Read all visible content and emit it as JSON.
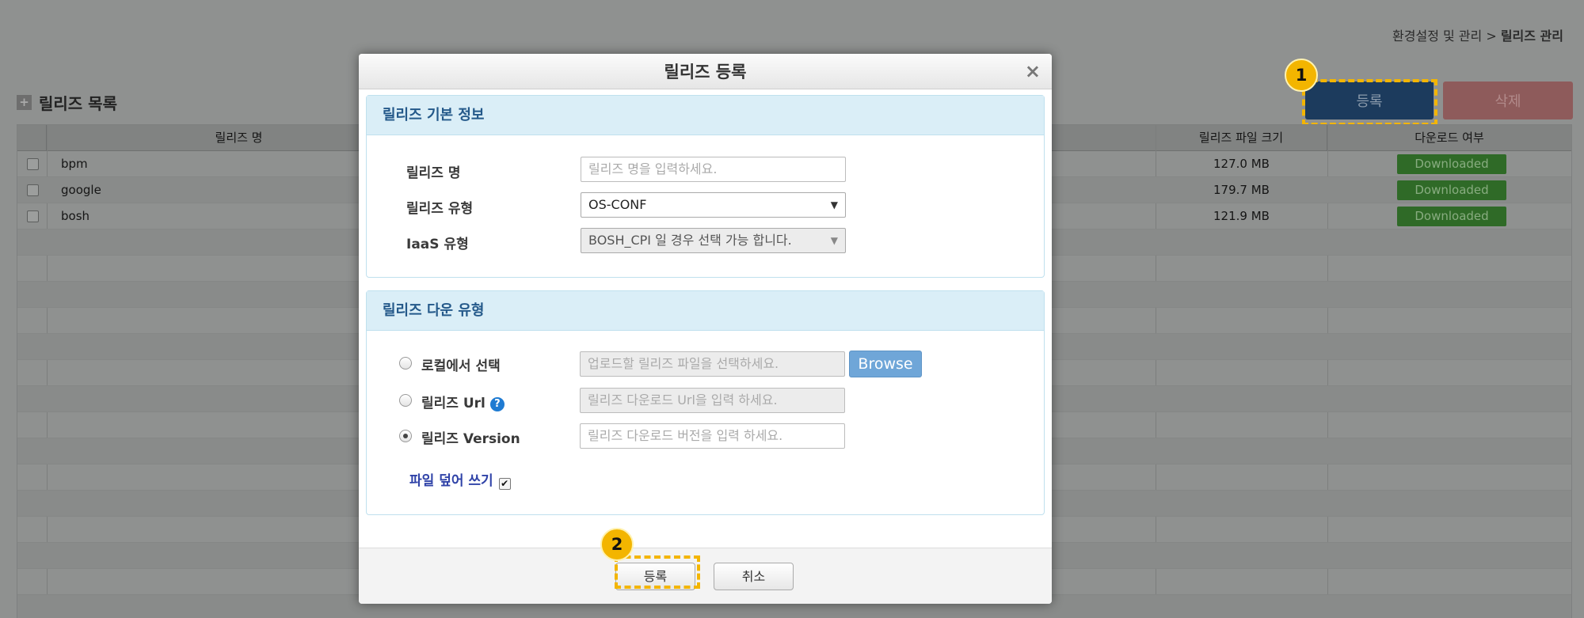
{
  "breadcrumb": {
    "parent": "환경설정 및 관리",
    "separator": " > ",
    "current": "릴리즈 관리"
  },
  "list": {
    "title": "릴리즈 목록"
  },
  "toolbar": {
    "register_label": "등록",
    "delete_label": "삭제"
  },
  "badges": {
    "one": "1",
    "two": "2"
  },
  "table": {
    "columns": [
      "릴리즈 명",
      "릴리즈 파일 크기",
      "다운로드 여부"
    ],
    "rows": [
      {
        "name": "bpm",
        "size": "127.0 MB",
        "status": "Downloaded"
      },
      {
        "name": "google",
        "size": "179.7 MB",
        "status": "Downloaded"
      },
      {
        "name": "bosh",
        "size": "121.9 MB",
        "status": "Downloaded"
      }
    ]
  },
  "modal": {
    "title": "릴리즈 등록",
    "close_glyph": "×",
    "basic": {
      "heading": "릴리즈 기본 정보",
      "name_label": "릴리즈 명",
      "name_placeholder": "릴리즈 명을 입력하세요.",
      "type_label": "릴리즈 유형",
      "type_value": "OS-CONF",
      "iaas_label": "IaaS 유형",
      "iaas_value": "BOSH_CPI 일 경우 선택 가능 합니다."
    },
    "download": {
      "heading": "릴리즈 다운 유형",
      "local_label": "로컬에서 선택",
      "local_placeholder": "업로드할 릴리즈 파일을 선택하세요.",
      "browse_label": "Browse",
      "url_label": "릴리즈 Url",
      "url_placeholder": "릴리즈 다운로드 Url을 입력 하세요.",
      "version_label": "릴리즈 Version",
      "version_placeholder": "릴리즈 다운로드 버전을 입력 하세요.",
      "overwrite_label": "파일 덮어 쓰기",
      "overwrite_checked": true
    },
    "footer": {
      "register_label": "등록",
      "cancel_label": "취소"
    }
  },
  "colors": {
    "highlight": "#f3b500",
    "primary": "#1c3b5d",
    "danger": "#8e5b5b",
    "success": "#2f6a27",
    "panel_head": "#daeef7"
  }
}
